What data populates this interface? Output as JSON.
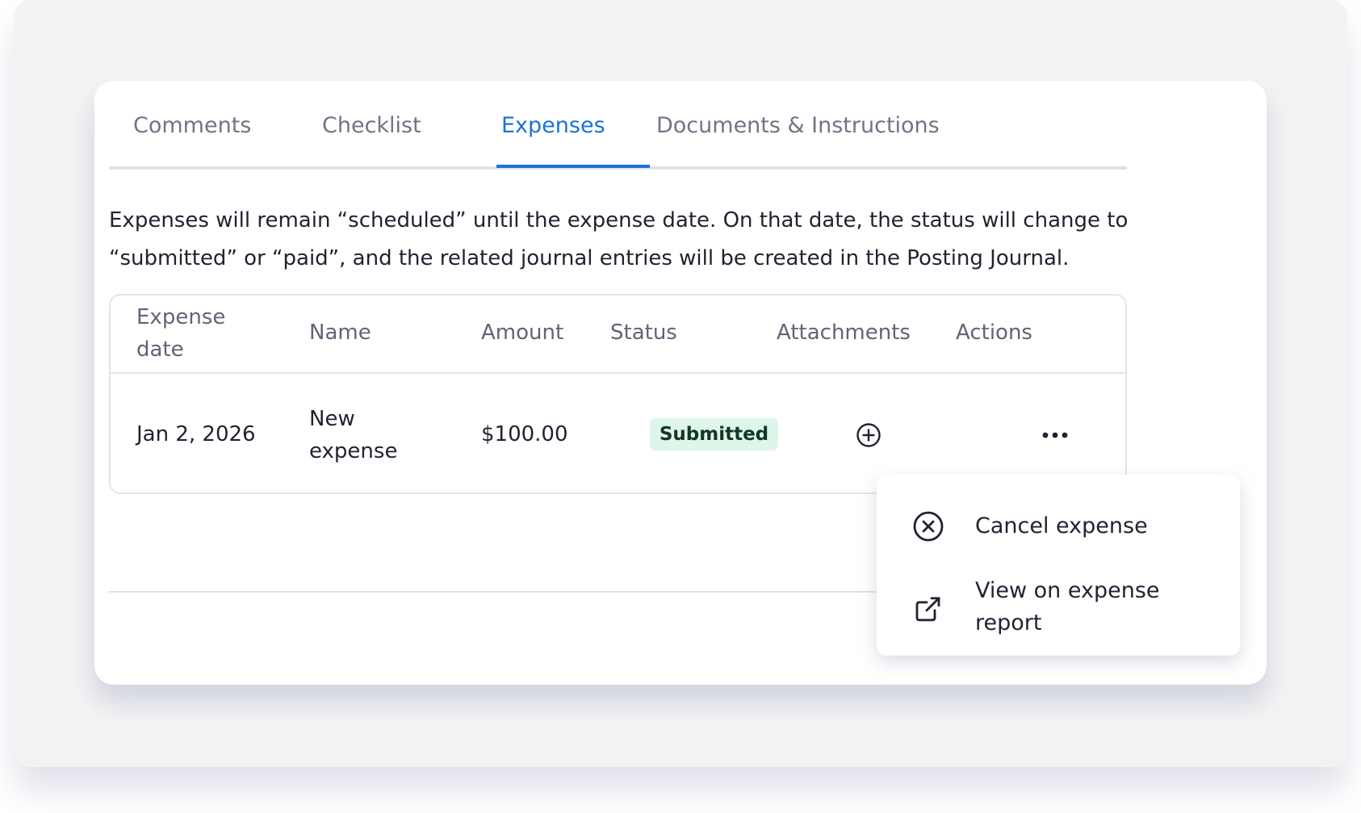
{
  "tabs": [
    {
      "label": "Comments",
      "active": false
    },
    {
      "label": "Checklist",
      "active": false
    },
    {
      "label": "Expenses",
      "active": true
    },
    {
      "label": "Documents & Instructions",
      "active": false
    }
  ],
  "description": {
    "line1": "Expenses will remain “scheduled” until the expense date. On that date, the status will change to",
    "line2": "“submitted” or “paid”, and the related journal entries will be created in the Posting Journal."
  },
  "table": {
    "headers": {
      "expense_date_line1": "Expense",
      "expense_date_line2": "date",
      "name": "Name",
      "amount": "Amount",
      "status": "Status",
      "attachments": "Attachments",
      "actions": "Actions"
    },
    "rows": [
      {
        "expense_date": "Jan 2, 2026",
        "name_line1": "New",
        "name_line2": "expense",
        "amount": "$100.00",
        "status": "Submitted",
        "attachments_icon": "add-circle-icon",
        "actions_icon": "more-horizontal-icon"
      }
    ]
  },
  "actions_menu": {
    "items": [
      {
        "label": "Cancel expense",
        "icon": "cancel-circle-icon"
      },
      {
        "label_line1": "View on expense",
        "label_line2": "report",
        "icon": "external-link-icon"
      }
    ]
  },
  "colors": {
    "accent": "#1a73d9",
    "status_submitted_bg": "#def5e9",
    "status_submitted_text": "#123628",
    "muted_text": "#707585",
    "body_text": "#1f2330"
  }
}
